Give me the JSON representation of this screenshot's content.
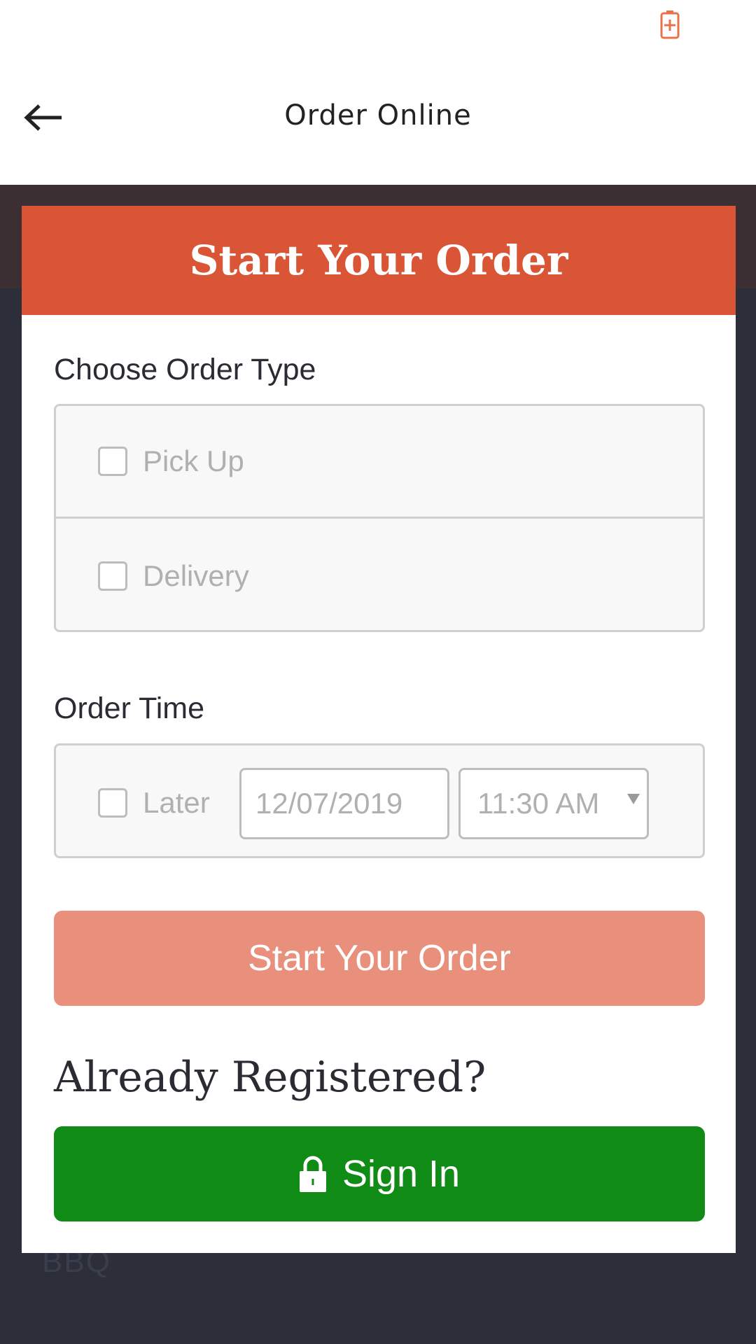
{
  "app_bar": {
    "title": "Order Online"
  },
  "icons": {
    "battery": "battery-charging-icon",
    "back": "arrow-left-icon",
    "checkbox": "checkbox-icon",
    "dropdown": "chevron-down-icon",
    "lock": "lock-icon"
  },
  "colors": {
    "accent": "#d95535",
    "start_button": "#e8907b",
    "signin_button": "#0f8b16",
    "battery": "#e8734a"
  },
  "modal": {
    "title": "Start Your Order",
    "order_type": {
      "label": "Choose Order Type",
      "options": [
        {
          "label": "Pick Up",
          "checked": false
        },
        {
          "label": "Delivery",
          "checked": false
        }
      ]
    },
    "order_time": {
      "label": "Order Time",
      "later_label": "Later",
      "later_checked": false,
      "date_value": "12/07/2019",
      "time_value": "11:30 AM"
    },
    "start_button_label": "Start Your Order",
    "registered_heading": "Already Registered?",
    "signin_label": "Sign In"
  },
  "background": {
    "footer_text": "BBQ"
  }
}
